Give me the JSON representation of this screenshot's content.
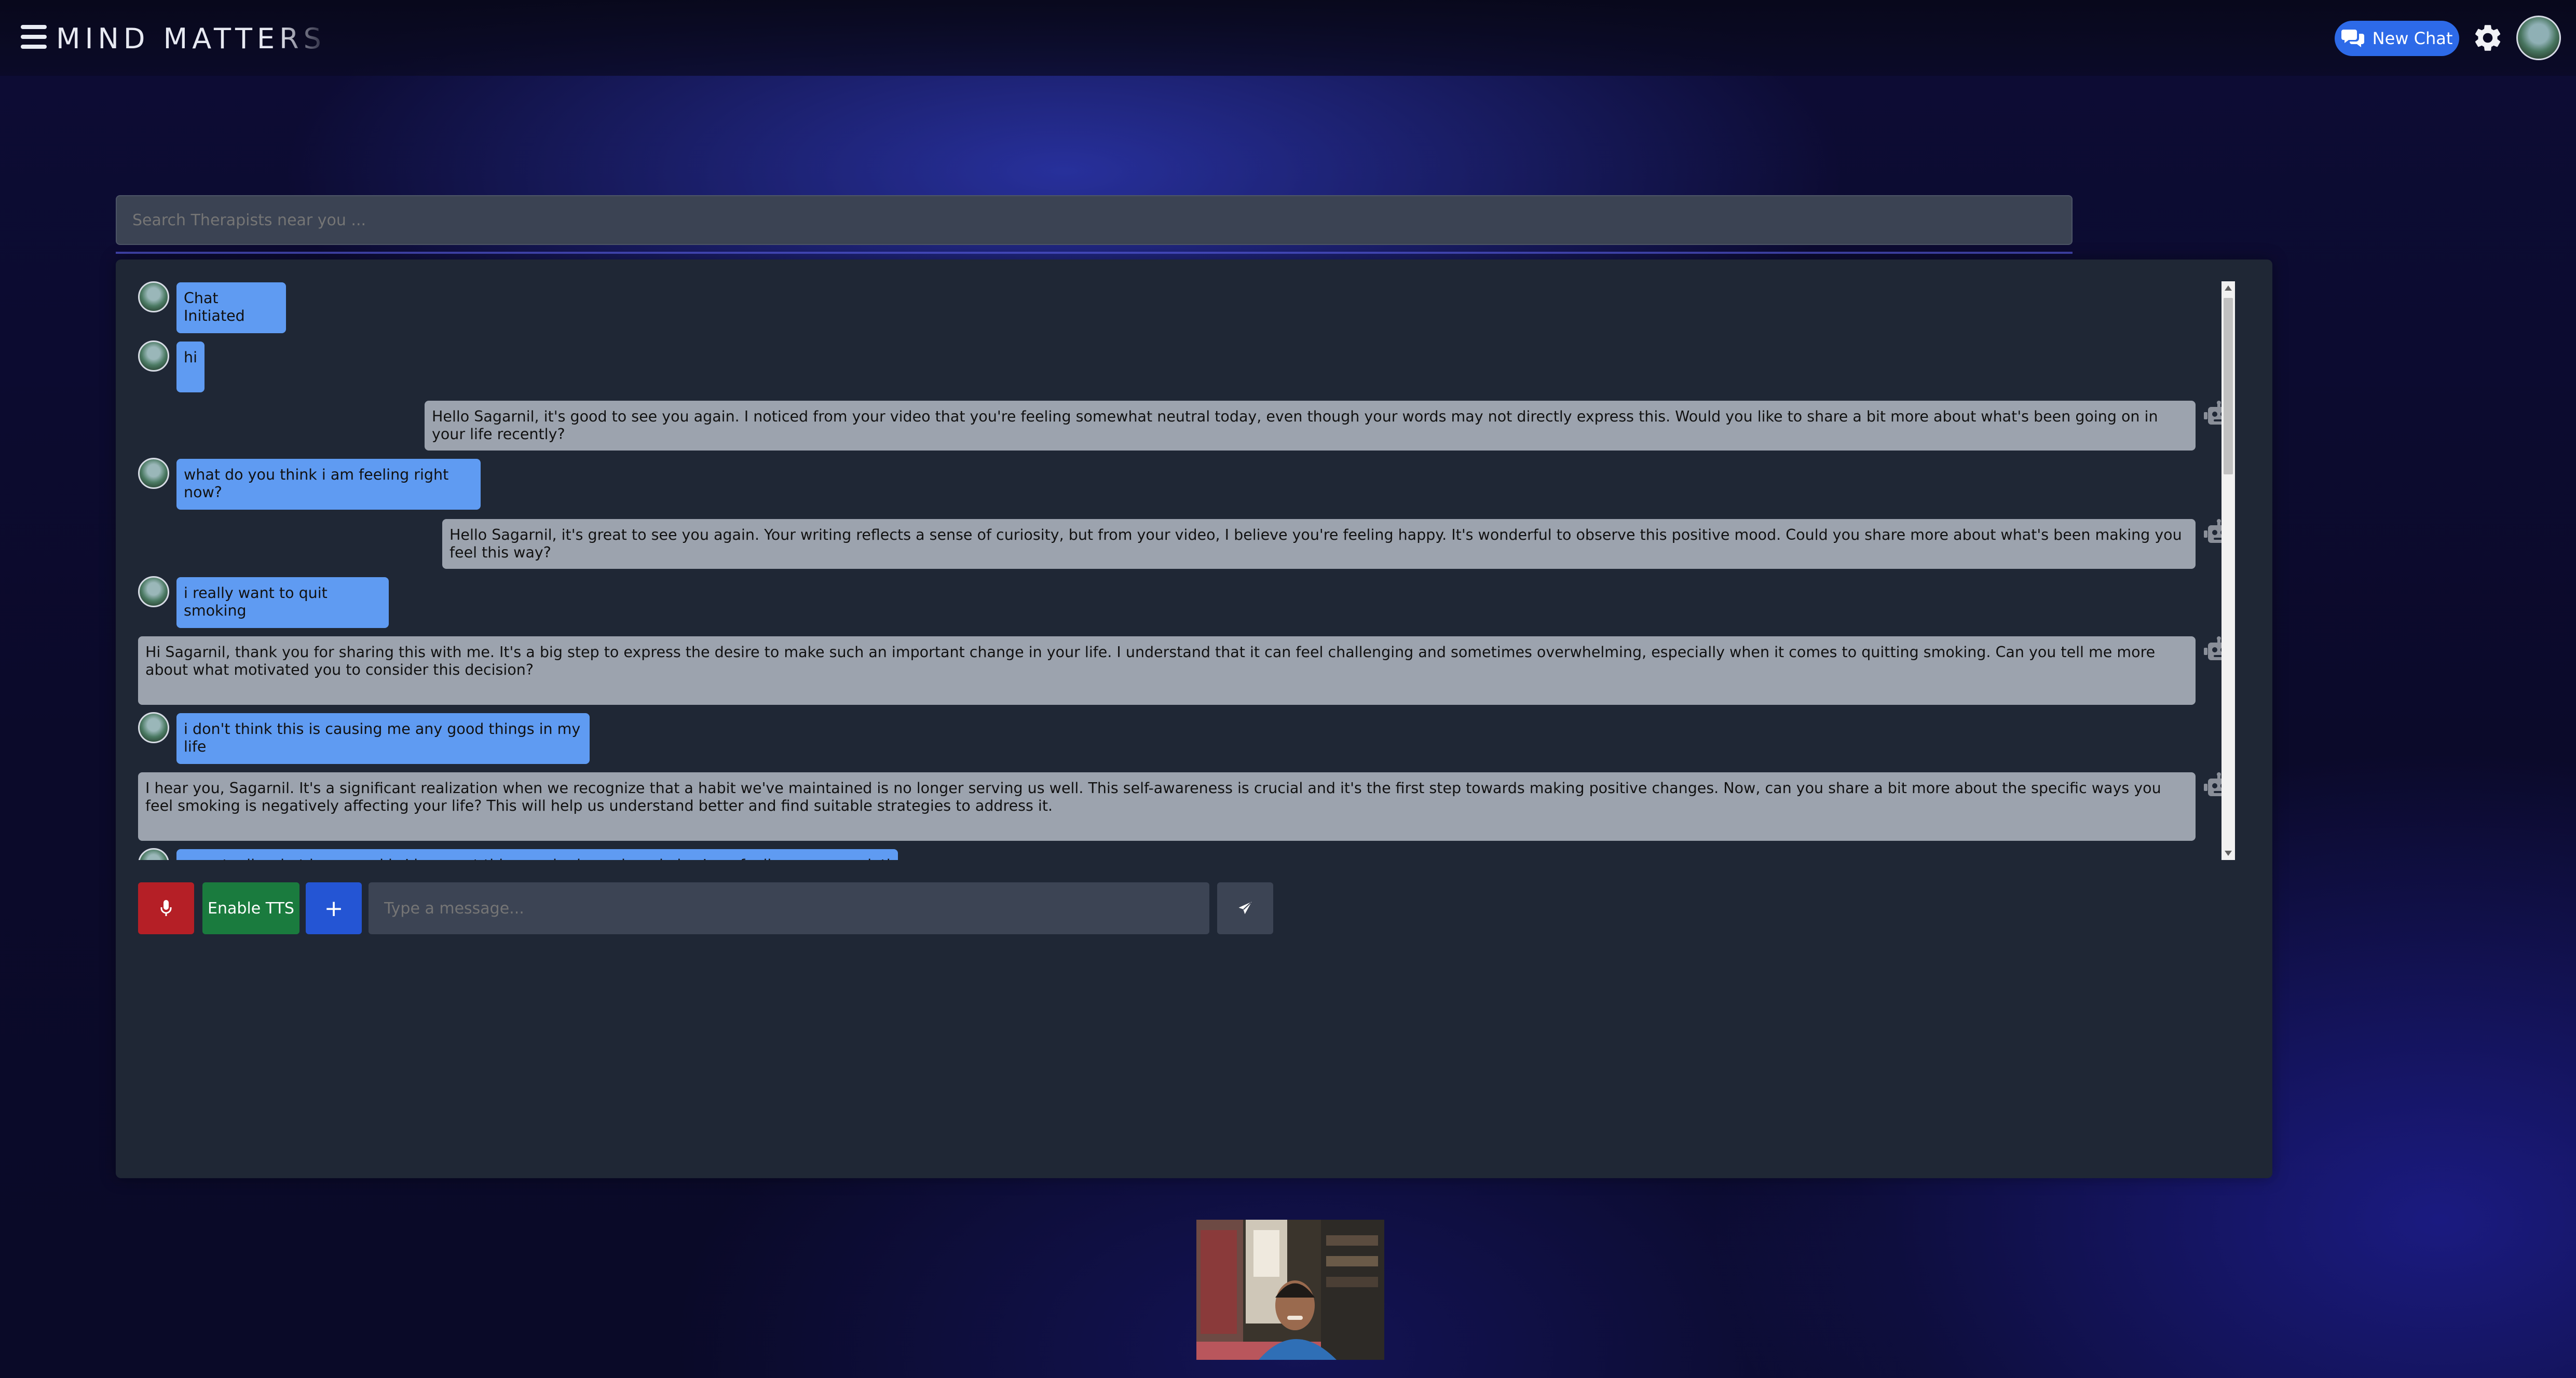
{
  "header": {
    "brand_main": "MIND MATTE",
    "brand_fade": "RS",
    "new_chat_label": "New Chat"
  },
  "search": {
    "placeholder": "Search Therapists near you ..."
  },
  "messages": [
    {
      "role": "user",
      "text": "Chat Initiated"
    },
    {
      "role": "user",
      "text": "hi"
    },
    {
      "role": "bot",
      "text": "Hello Sagarnil, it's good to see you again. I noticed from your video that you're feeling somewhat neutral today, even though your words may not directly express this. Would you like to share a bit more about what's been going on in your life recently?"
    },
    {
      "role": "user",
      "text": "what do you think i am feeling right now?"
    },
    {
      "role": "bot",
      "text": "Hello Sagarnil, it's great to see you again. Your writing reflects a sense of curiosity, but from your video, I believe you're feeling happy. It's wonderful to observe this positive mood. Could you share more about what's been making you feel this way?"
    },
    {
      "role": "user",
      "text": "i really want to quit smoking"
    },
    {
      "role": "bot",
      "text": "Hi Sagarnil, thank you for sharing this with me. It's a big step to express the desire to make such an important change in your life. I understand that it can feel challenging and sometimes overwhelming, especially when it comes to quitting smoking. Can you tell me more about what motivated you to consider this decision?"
    },
    {
      "role": "user",
      "text": "i don't think this is causing me any good things in my life"
    },
    {
      "role": "bot",
      "text": "I hear you, Sagarnil. It's a significant realization when we recognize that a habit we've maintained is no longer serving us well. This self-awareness is crucial and it's the first step towards making positive changes. Now, can you share a bit more about the specific ways you feel smoking is negatively affecting your life? This will help us understand better and find suitable strategies to address it."
    },
    {
      "role": "user",
      "text": "so actually what happened is I have got this very bad cough and also I am feeling someone lethargic"
    }
  ],
  "input": {
    "tts_label": "Enable TTS",
    "plus_label": "+",
    "placeholder": "Type a message..."
  },
  "icons": {
    "menu": "hamburger-icon",
    "new_chat": "chat-bubbles-icon",
    "settings": "gear-icon",
    "mic": "microphone-icon",
    "send": "paper-plane-icon",
    "bot": "robot-icon"
  },
  "colors": {
    "new_chat": "#2d6ae8",
    "user_bubble": "#5f9bf2",
    "bot_bubble": "#9ca3ae",
    "mic": "#b51f26",
    "tts": "#1a7b3e",
    "plus": "#2455d4",
    "panel": "#1f2735"
  }
}
